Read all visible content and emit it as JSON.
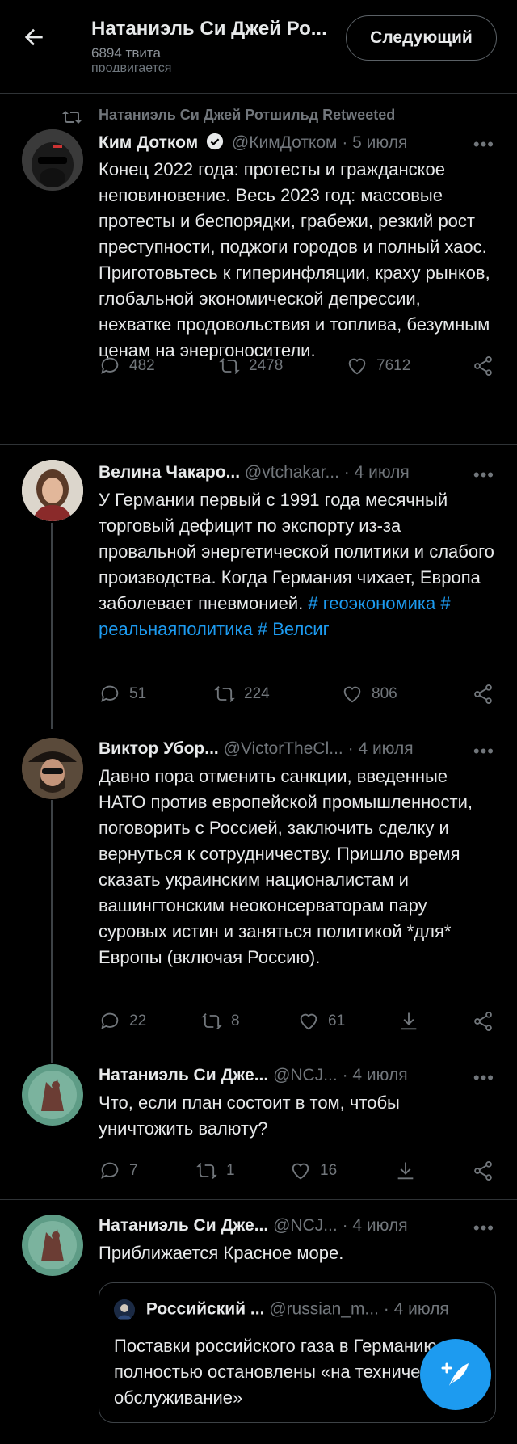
{
  "header": {
    "title": "Натаниэль Си Джей Ро...",
    "tweet_count": "6894 твита",
    "follow_label": "Следующий",
    "cut_text": "продвигается"
  },
  "tweets": [
    {
      "retweet_label": "Натаниэль Си Джей Ротшильд Retweeted",
      "name": "Ким Дотком",
      "verified": true,
      "handle": "@КимДотком",
      "date": "5 июля",
      "text": "Конец 2022 года: протесты и гражданское неповиновение. Весь 2023 год: массовые протесты и беспорядки, грабежи, резкий рост преступности, поджоги городов и полный хаос. Приготовьтесь к гиперинфляции, краху рынков, глобальной экономической депрессии, нехватке продовольствия и топлива, безумным ценам на энергоносители.",
      "replies": "482",
      "retweets": "2478",
      "likes": "7612"
    },
    {
      "name": "Велина Чакаро...",
      "handle": "@vtchakar...",
      "date": "4 июля",
      "text": "У Германии первый с 1991 года месячный торговый дефицит по экспорту из-за провальной энергетической политики и слабого производства. Когда Германия чихает, Европа заболевает пневмонией.",
      "hashtags": "# геоэкономика # реальнаяполитика # Велсиг",
      "replies": "51",
      "retweets": "224",
      "likes": "806"
    },
    {
      "name": "Виктор Убор...",
      "handle": "@VictorTheCl...",
      "date": "4 июля",
      "text": "Давно пора отменить санкции, введенные НАТО против европейской промышленности, поговорить с Россией, заключить сделку и вернуться к сотрудничеству. Пришло время сказать украинским националистам и вашингтонским неоконсерваторам пару суровых истин и заняться политикой *для* Европы (включая Россию).",
      "replies": "22",
      "retweets": "8",
      "likes": "61"
    },
    {
      "name": "Натаниэль Си Дже...",
      "handle": "@NCJ...",
      "date": "4 июля",
      "text": "Что, если план состоит в том, чтобы уничтожить валюту?",
      "replies": "7",
      "retweets": "1",
      "likes": "16"
    },
    {
      "name": "Натаниэль Си Дже...",
      "handle": "@NCJ...",
      "date": "4 июля",
      "text": "Приближается Красное море.",
      "quote": {
        "name": "Российский ...",
        "handle": "@russian_m...",
        "date": "4 июля",
        "text": "Поставки российского газа в Германию полностью остановлены «на техническое обслуживание»"
      }
    }
  ],
  "more_label": "•••",
  "dot": "·",
  "colors": {
    "accent": "#1d9bf0",
    "background": "#000000",
    "muted": "#71767b"
  }
}
